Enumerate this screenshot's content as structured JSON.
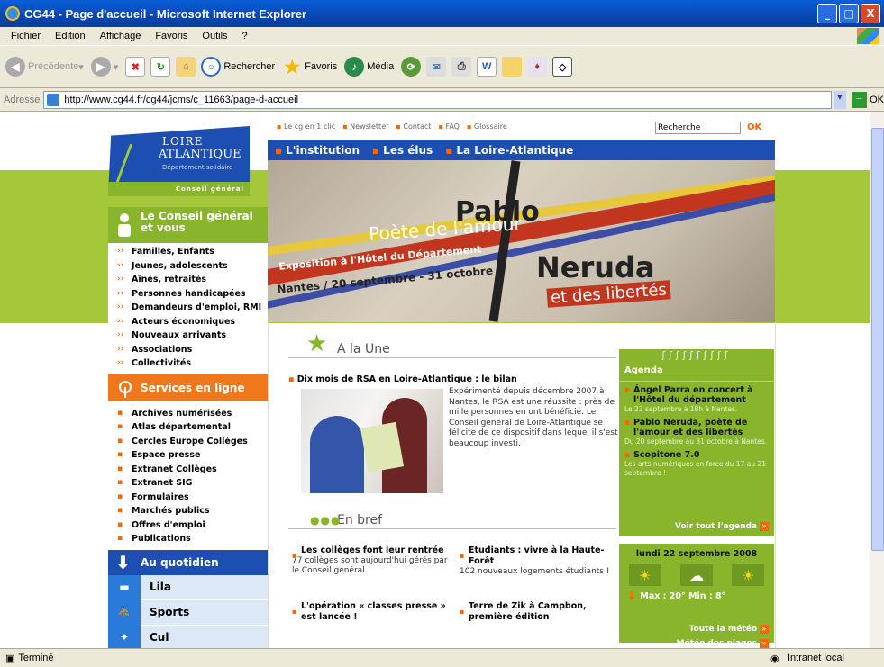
{
  "window": {
    "title": "CG44 - Page d'accueil - Microsoft Internet Explorer",
    "btns": [
      "_",
      "□",
      "X"
    ]
  },
  "menu": [
    "Fichier",
    "Edition",
    "Affichage",
    "Favoris",
    "Outils",
    "?"
  ],
  "toolbar": {
    "back": "Précédente",
    "search": "Rechercher",
    "favorites": "Favoris",
    "media": "Média"
  },
  "address": {
    "label": "Adresse",
    "url": "http://www.cg44.fr/cg44/jcms/c_11663/page-d-accueil",
    "go": "OK"
  },
  "site": {
    "topnav": [
      "Le cg en 1 clic",
      "Newsletter",
      "Contact",
      "FAQ",
      "Glossaire"
    ],
    "search_value": "Recherche",
    "search_ok": "OK",
    "logo": {
      "l1": "LOIRE",
      "l2": "ATLANTIQUE",
      "l3": "Département solidaire",
      "tag": "Conseil général"
    },
    "mainnav": [
      "L'institution",
      "Les élus",
      "La Loire-Atlantique"
    ],
    "banner": {
      "pablo": "Pablo",
      "poete": "Poète de l'amour",
      "neruda": "Neruda",
      "expo": "Exposition à l'Hôtel du Département",
      "nantes": "Nantes / 20 septembre - 31 octobre",
      "lib": "et des libertés"
    },
    "sb1": {
      "title": "Le Conseil général et vous",
      "items": [
        "Familles, Enfants",
        "Jeunes, adolescents",
        "Aînés, retraités",
        "Personnes handicapées",
        "Demandeurs d'emploi, RMI",
        "Acteurs économiques",
        "Nouveaux arrivants",
        "Associations",
        "Collectivités"
      ]
    },
    "sb2": {
      "title": "Services en ligne",
      "items": [
        "Archives numérisées",
        "Atlas départemental",
        "Cercles Europe Collèges",
        "Espace presse",
        "Extranet Collèges",
        "Extranet SIG",
        "Formulaires",
        "Marchés publics",
        "Offres d'emploi",
        "Publications"
      ]
    },
    "sb3": {
      "title": "Au quotidien",
      "items": [
        "Lila",
        "Sports",
        "Cul"
      ]
    },
    "une": {
      "title": "A la Une",
      "rsa_title": "Dix mois de RSA en Loire-Atlantique : le bilan",
      "rsa_text": "Expérimenté depuis décembre 2007 à Nantes, le RSA est une réussite : près de mille personnes en ont bénéficié. Le Conseil général de Loire-Atlantique se félicite de ce dispositif dans lequel il s'est beaucoup investi."
    },
    "enbref": {
      "title": "En bref",
      "n1h": "Les collèges font leur rentrée",
      "n1b": "77 collèges sont aujourd'hui gérés par le Conseil général.",
      "n2h": "Etudiants : vivre à la Haute-Forêt",
      "n2b": "102 nouveaux logements étudiants !",
      "n3h": "L'opération « classes presse » est lancée !",
      "n4h": "Terre de Zik à Campbon, première édition"
    },
    "agenda": {
      "title": "Agenda",
      "e1t": "Ángel Parra en concert à l'Hôtel du département",
      "e1d": "Le 23 septembre à 18h à Nantes.",
      "e2t": "Pablo Neruda, poète de l'amour et des libertés",
      "e2d": "Du 20 septembre au 31 octobre à Nantes.",
      "e3t": "Scopitone 7.0",
      "e3d": "Les arts numériques en force du 17 au 21 septembre !",
      "all": "Voir tout l'agenda"
    },
    "meteo": {
      "date": "lundi 22 septembre 2008",
      "minmax": "Max : 20° Min : 8°",
      "link1": "Toute la météo",
      "link2": "Météo des plages"
    }
  },
  "status": {
    "left": "Terminé",
    "right": "Intranet local"
  }
}
